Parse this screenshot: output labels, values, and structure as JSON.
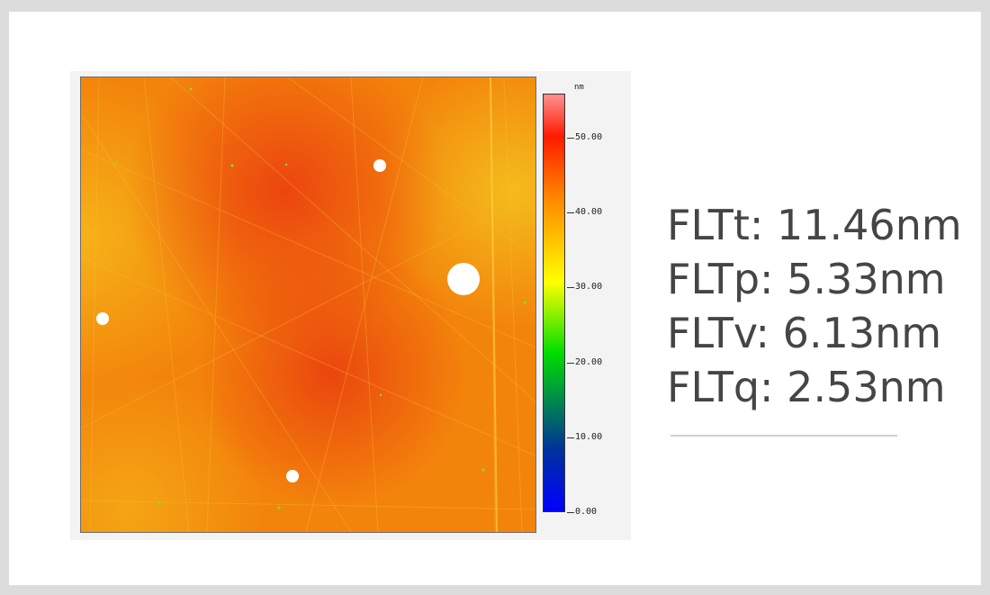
{
  "colorbar": {
    "unit": "nm",
    "ticks": [
      {
        "value": 50,
        "label": "50.00"
      },
      {
        "value": 40,
        "label": "40.00"
      },
      {
        "value": 30,
        "label": "30.00"
      },
      {
        "value": 20,
        "label": "20.00"
      },
      {
        "value": 10,
        "label": "10.00"
      },
      {
        "value": 0,
        "label": "0.00"
      }
    ],
    "colors": [
      "#0000ff",
      "#0033cc",
      "#00ff00",
      "#ffff00",
      "#ff8800",
      "#ff0000",
      "#ff8080"
    ]
  },
  "image": {
    "dominant_color": "#f3840b"
  },
  "stats": [
    {
      "label": "FLTt: 11.46nm"
    },
    {
      "label": "FLTp: 5.33nm"
    },
    {
      "label": "FLTv: 6.13nm"
    },
    {
      "label": "FLTq: 2.53nm"
    }
  ]
}
